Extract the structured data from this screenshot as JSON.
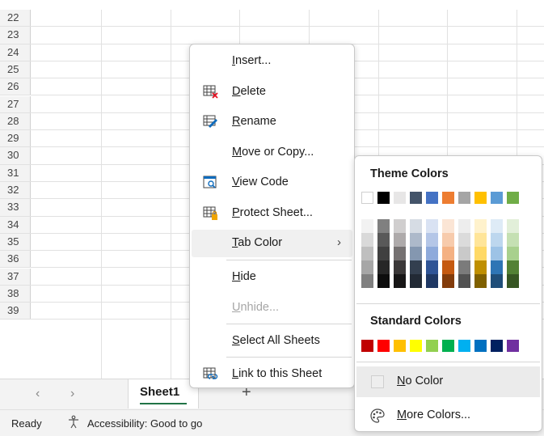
{
  "rows": [
    "22",
    "23",
    "24",
    "25",
    "26",
    "27",
    "28",
    "29",
    "30",
    "31",
    "32",
    "33",
    "34",
    "35",
    "36",
    "37",
    "38",
    "39"
  ],
  "tabs": {
    "prev_icon": "chevron-left-icon",
    "next_icon": "chevron-right-icon",
    "sheet_name": "Sheet1",
    "add_label": "+"
  },
  "status": {
    "ready": "Ready",
    "accessibility": "Accessibility: Good to go"
  },
  "menu": {
    "insert": {
      "pre": "",
      "key": "I",
      "post": "nsert..."
    },
    "delete": {
      "pre": "",
      "key": "D",
      "post": "elete"
    },
    "rename": {
      "pre": "",
      "key": "R",
      "post": "ename"
    },
    "move": {
      "pre": "",
      "key": "M",
      "post": "ove or Copy..."
    },
    "view": {
      "pre": "",
      "key": "V",
      "post": "iew Code"
    },
    "protect": {
      "pre": "",
      "key": "P",
      "post": "rotect Sheet..."
    },
    "tabcolor": {
      "pre": "",
      "key": "T",
      "post": "ab Color",
      "chevron": "›"
    },
    "hide": {
      "pre": "",
      "key": "H",
      "post": "ide"
    },
    "unhide": {
      "pre": "",
      "key": "U",
      "post": "nhide..."
    },
    "selectall": {
      "pre": "",
      "key": "S",
      "post": "elect All Sheets"
    },
    "link": {
      "pre": "",
      "key": "L",
      "post": "ink to this Sheet"
    }
  },
  "palette": {
    "theme_title": "Theme Colors",
    "standard_title": "Standard Colors",
    "no_color": {
      "key": "N",
      "post": "o Color"
    },
    "more_colors": {
      "key": "M",
      "post": "ore Colors..."
    },
    "theme_top": [
      "#FFFFFF",
      "#000000",
      "#E7E6E6",
      "#44546A",
      "#4472C4",
      "#ED7D31",
      "#A5A5A5",
      "#FFC000",
      "#5B9BD5",
      "#70AD47"
    ],
    "theme_shades": [
      [
        "#F2F2F2",
        "#D9D9D9",
        "#BFBFBF",
        "#A6A6A6",
        "#808080"
      ],
      [
        "#808080",
        "#595959",
        "#404040",
        "#262626",
        "#0D0D0D"
      ],
      [
        "#D0CECE",
        "#AEAAAA",
        "#757171",
        "#3B3838",
        "#171616"
      ],
      [
        "#D6DCE4",
        "#ADB9CA",
        "#8497B0",
        "#333F4F",
        "#222A35"
      ],
      [
        "#D9E2F3",
        "#B4C6E7",
        "#8EAADB",
        "#2F5496",
        "#1F3864"
      ],
      [
        "#FBE5D5",
        "#F7CBAC",
        "#F4B183",
        "#C55A11",
        "#833C0B"
      ],
      [
        "#EDEDED",
        "#DBDBDB",
        "#C9C9C9",
        "#7B7B7B",
        "#525252"
      ],
      [
        "#FFF2CC",
        "#FFE599",
        "#FFD966",
        "#BF8F00",
        "#7F6000"
      ],
      [
        "#DEEBF6",
        "#BDD7EE",
        "#9DC3E6",
        "#2E75B5",
        "#1F4E79"
      ],
      [
        "#E2EFD9",
        "#C5E0B3",
        "#A8D08D",
        "#538135",
        "#375623"
      ]
    ],
    "standard": [
      "#C00000",
      "#FF0000",
      "#FFC000",
      "#FFFF00",
      "#92D050",
      "#00B050",
      "#00B0F0",
      "#0070C0",
      "#002060",
      "#7030A0"
    ]
  }
}
